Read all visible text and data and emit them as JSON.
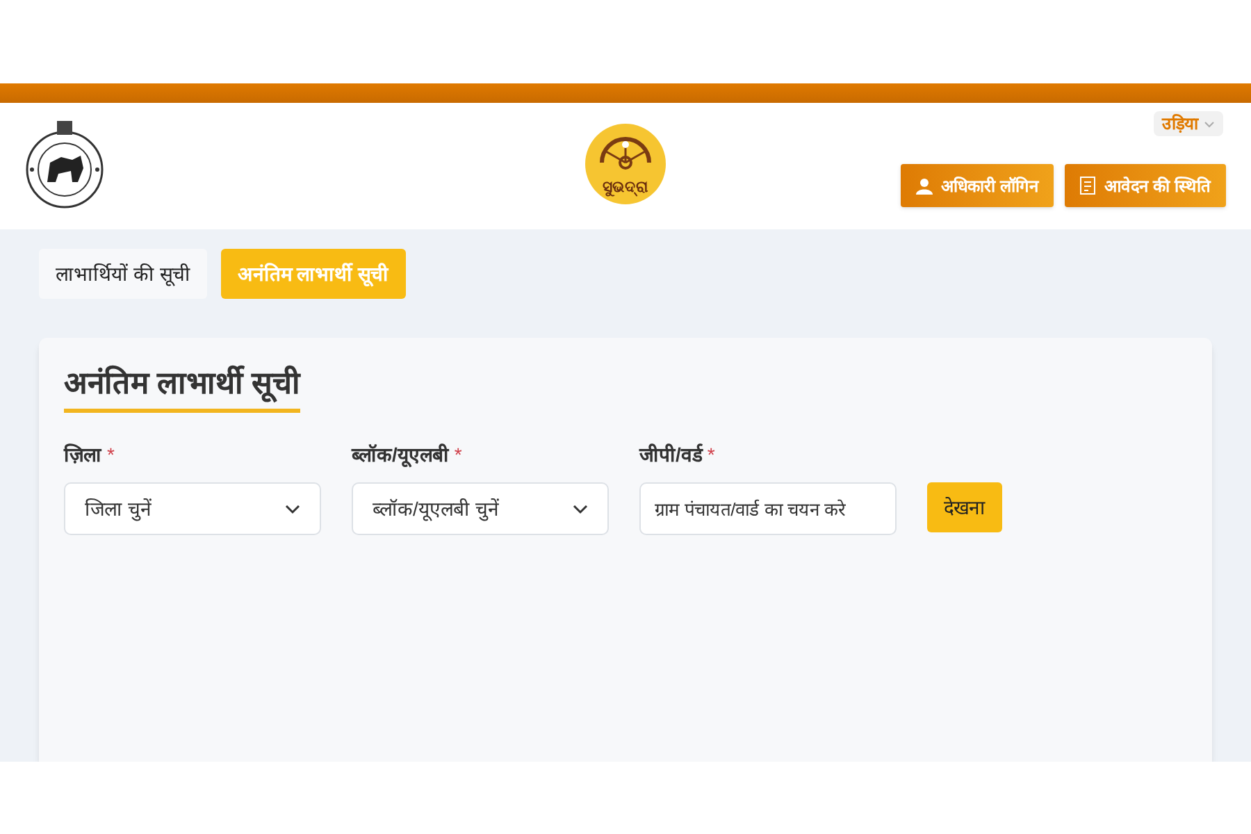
{
  "header": {
    "logo_text": "ସୁଭଦ୍ରା",
    "language": "उड़िया",
    "buttons": [
      {
        "kind": "login",
        "label": "अधिकारी लॉगिन"
      },
      {
        "kind": "status",
        "label": "आवेदन की स्थिति"
      }
    ]
  },
  "tabs": [
    {
      "label": "लाभार्थियों की सूची",
      "selected": false
    },
    {
      "label": "अनंतिम लाभार्थी सूची",
      "selected": true
    }
  ],
  "card": {
    "title": "अनंतिम लाभार्थी सूची",
    "fields": [
      {
        "kind": "select",
        "label": "ज़िला",
        "required_mark": "*",
        "placeholder": "जिला चुनें"
      },
      {
        "kind": "select",
        "label": "ब्लॉक/यूएलबी",
        "required_mark": "*",
        "placeholder": "ब्लॉक/यूएलबी चुनें"
      },
      {
        "kind": "text",
        "label": "जीपी/वर्ड",
        "required_mark": "*",
        "placeholder": "ग्राम पंचायत/वार्ड का चयन करे"
      }
    ],
    "button": "देखना"
  }
}
